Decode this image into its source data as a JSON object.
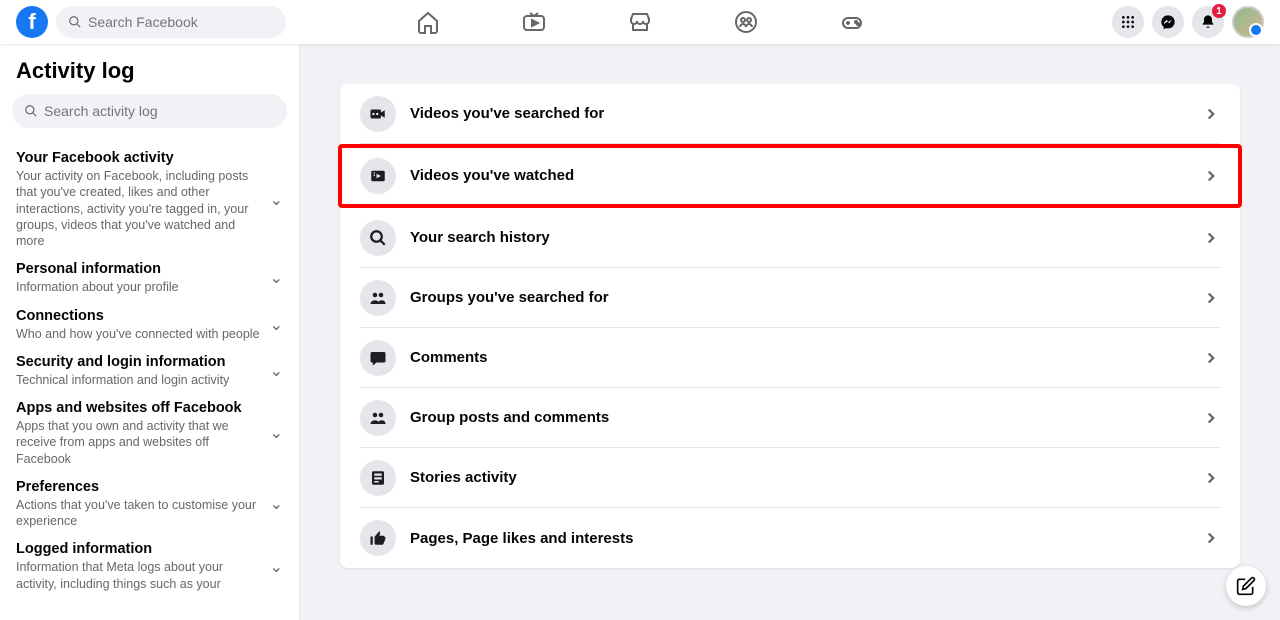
{
  "header": {
    "search_placeholder": "Search Facebook",
    "notif_badge": "1"
  },
  "page": {
    "title": "Activity log",
    "search_placeholder": "Search activity log"
  },
  "sidebar": [
    {
      "title": "Your Facebook activity",
      "desc": "Your activity on Facebook, including posts that you've created, likes and other interactions, activity you're tagged in, your groups, videos that you've watched and more"
    },
    {
      "title": "Personal information",
      "desc": "Information about your profile"
    },
    {
      "title": "Connections",
      "desc": "Who and how you've connected with people"
    },
    {
      "title": "Security and login information",
      "desc": "Technical information and login activity"
    },
    {
      "title": "Apps and websites off Facebook",
      "desc": "Apps that you own and activity that we receive from apps and websites off Facebook"
    },
    {
      "title": "Preferences",
      "desc": "Actions that you've taken to customise your experience"
    },
    {
      "title": "Logged information",
      "desc": "Information that Meta logs about your activity, including things such as your"
    }
  ],
  "rows": [
    {
      "label": "Videos you've searched for",
      "icon": "video-search",
      "highlight": false
    },
    {
      "label": "Videos you've watched",
      "icon": "video-watched",
      "highlight": true
    },
    {
      "label": "Your search history",
      "icon": "search",
      "highlight": false
    },
    {
      "label": "Groups you've searched for",
      "icon": "group",
      "highlight": false
    },
    {
      "label": "Comments",
      "icon": "comment",
      "highlight": false
    },
    {
      "label": "Group posts and comments",
      "icon": "group",
      "highlight": false
    },
    {
      "label": "Stories activity",
      "icon": "stories",
      "highlight": false
    },
    {
      "label": "Pages, Page likes and interests",
      "icon": "like",
      "highlight": false
    }
  ]
}
